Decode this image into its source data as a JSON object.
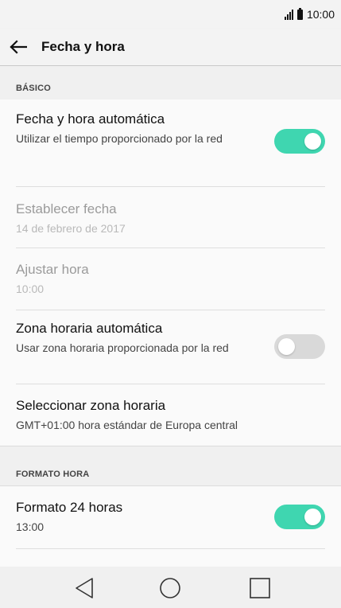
{
  "status_bar": {
    "time": "10:00"
  },
  "header": {
    "title": "Fecha y hora"
  },
  "sections": {
    "basic": {
      "label": "BÁSICO"
    },
    "time_format": {
      "label": "FORMATO HORA"
    }
  },
  "settings": {
    "auto_datetime": {
      "title": "Fecha y hora automática",
      "summary": "Utilizar el tiempo proporcionado por la red",
      "enabled": true
    },
    "set_date": {
      "title": "Establecer fecha",
      "summary": "14 de febrero de 2017"
    },
    "set_time": {
      "title": "Ajustar hora",
      "summary": "10:00"
    },
    "auto_timezone": {
      "title": "Zona horaria automática",
      "summary": "Usar zona horaria proporcionada por la red",
      "enabled": false
    },
    "select_timezone": {
      "title": "Seleccionar zona horaria",
      "summary": "GMT+01:00 hora estándar de Europa central"
    },
    "format_24h": {
      "title": "Formato 24 horas",
      "summary": "13:00",
      "enabled": true
    }
  },
  "colors": {
    "toggle_on": "#3fd6b0",
    "toggle_off": "#d9d9d9"
  },
  "icons": {
    "back": "arrow-left-icon",
    "nav_back": "triangle-back-icon",
    "nav_home": "circle-home-icon",
    "nav_recents": "square-recents-icon"
  }
}
